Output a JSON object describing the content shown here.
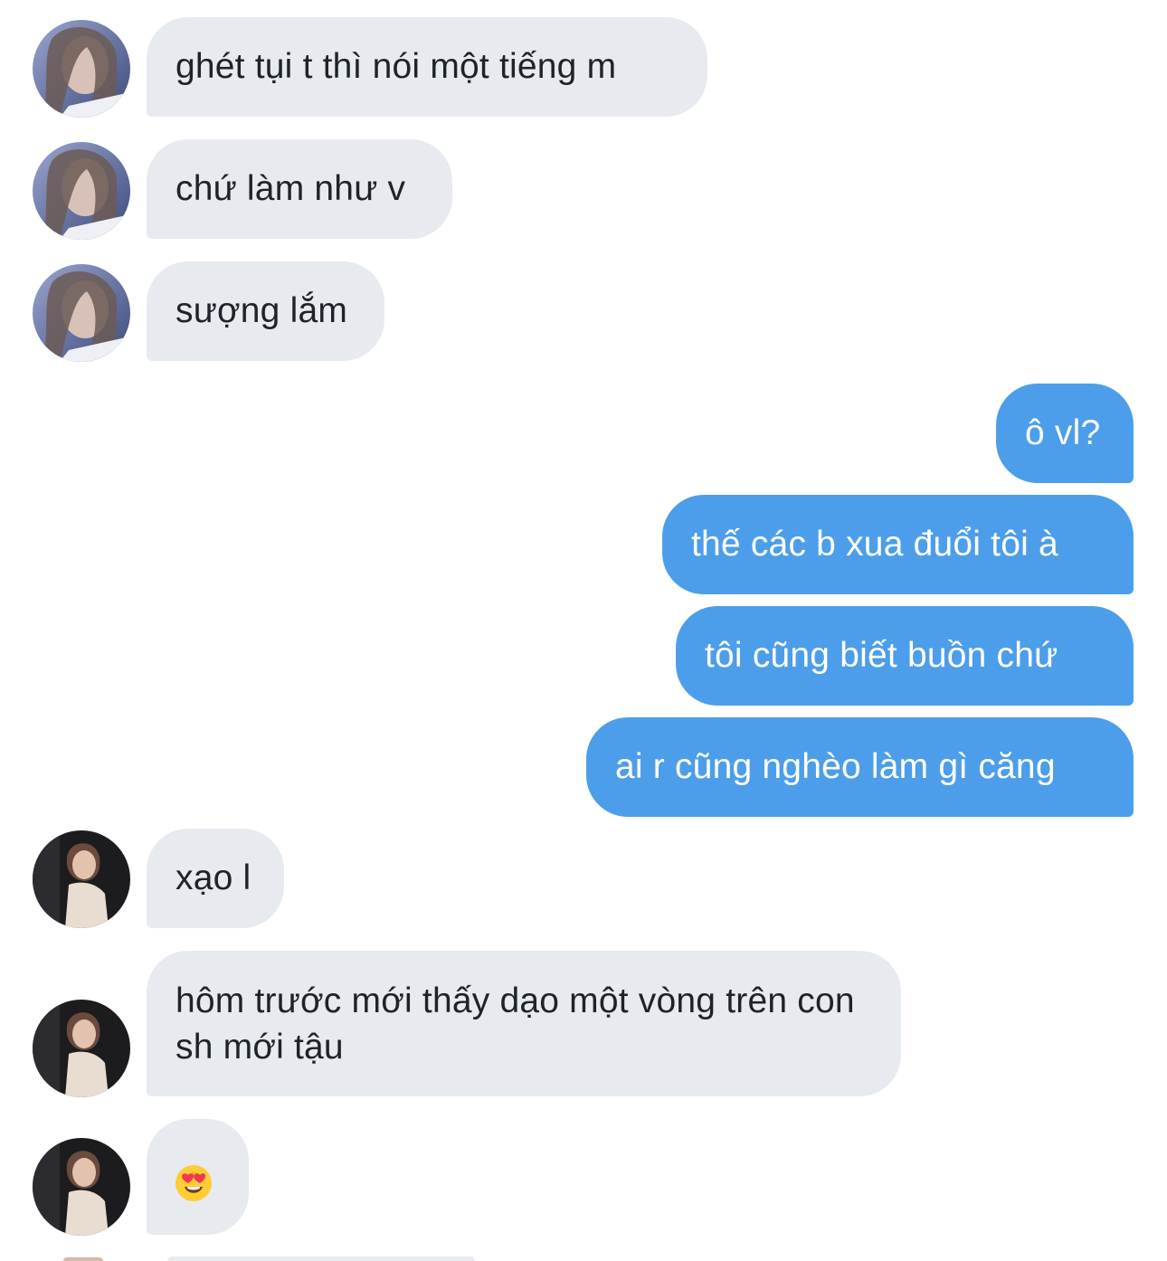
{
  "contacts": {
    "user_a": {
      "avatar_icon": "profile-photo-avatar-light",
      "accent": "#c9cfe6"
    },
    "user_b": {
      "avatar_icon": "profile-photo-avatar-dark",
      "accent": "#1c1c1f"
    }
  },
  "messages": [
    {
      "sender": "user_a",
      "direction": "incoming",
      "text": "ghét tụi t thì nói một tiếng m"
    },
    {
      "sender": "user_a",
      "direction": "incoming",
      "text": "chứ làm như v"
    },
    {
      "sender": "user_a",
      "direction": "incoming",
      "text": "sượng lắm"
    },
    {
      "sender": "me",
      "direction": "outgoing",
      "text": "ô vl?"
    },
    {
      "sender": "me",
      "direction": "outgoing",
      "text": "thế các b xua đuổi tôi à"
    },
    {
      "sender": "me",
      "direction": "outgoing",
      "text": "tôi cũng biết buồn chứ"
    },
    {
      "sender": "me",
      "direction": "outgoing",
      "text": "ai r cũng nghèo làm gì căng"
    },
    {
      "sender": "user_b",
      "direction": "incoming",
      "text": "xạo l"
    },
    {
      "sender": "user_b",
      "direction": "incoming",
      "text": "hôm trước mới thấy dạo một vòng trên con sh mới tậu"
    },
    {
      "sender": "user_b",
      "direction": "incoming",
      "emoji_icon": "heart-eyes-emoji-icon"
    }
  ],
  "colors": {
    "incoming_bubble": "#e7eaee",
    "outgoing_bubble": "#4c9eea",
    "incoming_text": "#1f2329",
    "outgoing_text": "#ffffff"
  }
}
